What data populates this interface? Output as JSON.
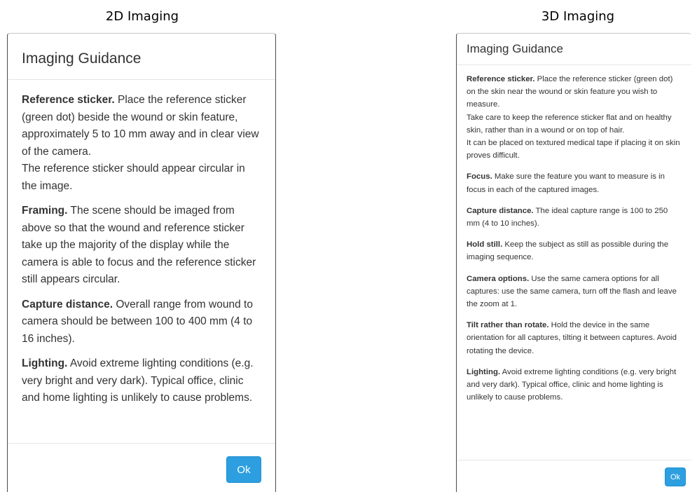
{
  "captions": {
    "left": "2D Imaging",
    "right": "3D Imaging"
  },
  "dialog_2d": {
    "title": "Imaging Guidance",
    "ok_label": "Ok",
    "reference": {
      "heading": "Reference sticker.",
      "line1": " Place the reference sticker (green dot) beside the wound or skin feature, approximately 5 to 10 mm away and in clear view of the camera.",
      "line2": "The reference sticker should appear circular in the image."
    },
    "framing": {
      "heading": "Framing.",
      "text": " The scene should be imaged from above so that the wound and reference sticker take up the majority of the display while the camera is able to focus and the reference sticker still appears circular."
    },
    "capture": {
      "heading": "Capture distance.",
      "text": " Overall range from wound to camera should be between 100 to 400 mm (4 to 16 inches)."
    },
    "lighting": {
      "heading": "Lighting.",
      "text": " Avoid extreme lighting conditions (e.g. very bright and very dark). Typical office, clinic and home lighting is unlikely to cause problems."
    }
  },
  "dialog_3d": {
    "title": "Imaging Guidance",
    "ok_label": "Ok",
    "reference": {
      "heading": "Reference sticker.",
      "line1": " Place the reference sticker (green dot) on the skin near the wound or skin feature you wish to measure.",
      "line2": "Take care to keep the reference sticker flat and on healthy skin, rather than in a wound or on top of hair.",
      "line3": "It can be placed on textured medical tape if placing it on skin proves difficult."
    },
    "focus": {
      "heading": "Focus.",
      "text": " Make sure the feature you want to measure is in focus in each of the captured images."
    },
    "capture": {
      "heading": "Capture distance.",
      "text": " The ideal capture range is 100 to 250 mm (4 to 10 inches)."
    },
    "hold": {
      "heading": "Hold still.",
      "text": " Keep the subject as still as possible during the imaging sequence."
    },
    "camera": {
      "heading": "Camera options.",
      "text": " Use the same camera options for all captures: use the same camera, turn off the flash and leave the zoom at 1."
    },
    "tilt": {
      "heading": "Tilt rather than rotate.",
      "text": " Hold the device in the same orientation for all captures, tilting it between captures. Avoid rotating the device."
    },
    "lighting": {
      "heading": "Lighting.",
      "text": " Avoid extreme lighting conditions (e.g. very bright and very dark). Typical office, clinic and home lighting is unlikely to cause problems."
    }
  }
}
